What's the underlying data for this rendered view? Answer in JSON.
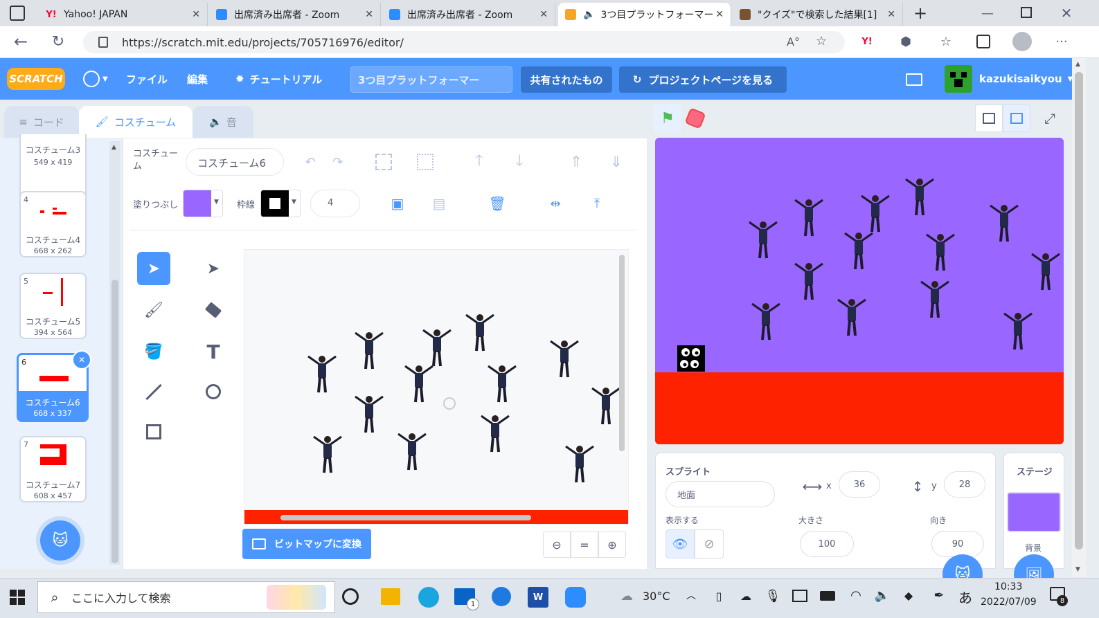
{
  "browser": {
    "tabs": [
      {
        "label": "Yahoo! JAPAN",
        "color": "#ff0033"
      },
      {
        "label": "出席済み出席者 - Zoom",
        "color": "#2d8cff"
      },
      {
        "label": "出席済み出席者 - Zoom",
        "color": "#2d8cff"
      },
      {
        "label": "3つ目プラットフォーマー",
        "color": "#f5a623"
      },
      {
        "label": "\"クイズ\"で検索した結果[1]",
        "color": "#7a5230"
      }
    ],
    "url": "https://scratch.mit.edu/projects/705716976/editor/"
  },
  "menu": {
    "logo": "SCRATCH",
    "file": "ファイル",
    "edit": "編集",
    "tutorial": "チュートリアル",
    "project_title": "3つ目プラットフォーマー",
    "shared": "共有されたもの",
    "see_project_page": "プロジェクトページを見る",
    "username": "kazukisaikyou"
  },
  "editor_tabs": {
    "code": "コード",
    "costumes": "コスチューム",
    "sounds": "音"
  },
  "costumes": [
    {
      "num": "",
      "name": "コスチューム3",
      "size": "549 x 419"
    },
    {
      "num": "4",
      "name": "コスチューム4",
      "size": "668 x 262"
    },
    {
      "num": "5",
      "name": "コスチューム5",
      "size": "394 x 564"
    },
    {
      "num": "6",
      "name": "コスチューム6",
      "size": "668 x 337"
    },
    {
      "num": "7",
      "name": "コスチューム7",
      "size": "608 x 457"
    }
  ],
  "paint": {
    "costume_label": "コスチューム",
    "costume_name": "コスチューム6",
    "fill_label": "塗りつぶし",
    "outline_label": "枠線",
    "outline_width": "4",
    "fill_color": "#9966ff",
    "convert_bitmap": "ビットマップに変換"
  },
  "sprite": {
    "title": "スプライト",
    "name": "地面",
    "x_label": "x",
    "x": "36",
    "y_label": "y",
    "y": "28",
    "show_label": "表示する",
    "size_label": "大きさ",
    "size": "100",
    "direction_label": "向き",
    "direction": "90"
  },
  "stage_pane": {
    "title": "ステージ",
    "backdrop_label": "背景"
  },
  "taskbar": {
    "search_placeholder": "ここに入力して検索",
    "weather": "30°C",
    "ime": "あ",
    "time": "10:33",
    "date": "2022/07/09",
    "notification_count": "8",
    "mail_badge": "1"
  },
  "colors": {
    "scratch_blue": "#4c97ff",
    "stage_bg": "#9966ff",
    "ground": "#ff2200"
  }
}
